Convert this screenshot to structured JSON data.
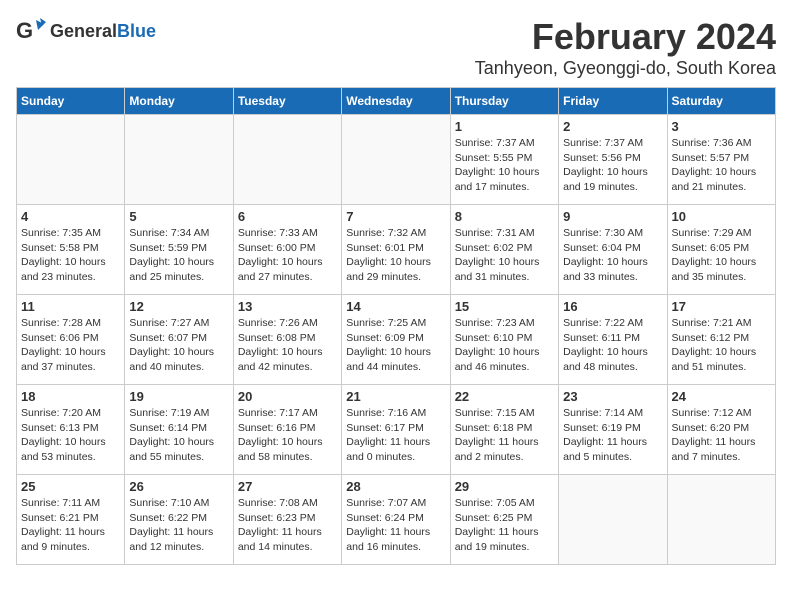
{
  "header": {
    "logo_general": "General",
    "logo_blue": "Blue",
    "month_year": "February 2024",
    "location": "Tanhyeon, Gyeonggi-do, South Korea"
  },
  "weekdays": [
    "Sunday",
    "Monday",
    "Tuesday",
    "Wednesday",
    "Thursday",
    "Friday",
    "Saturday"
  ],
  "weeks": [
    [
      {
        "day": "",
        "info": ""
      },
      {
        "day": "",
        "info": ""
      },
      {
        "day": "",
        "info": ""
      },
      {
        "day": "",
        "info": ""
      },
      {
        "day": "1",
        "info": "Sunrise: 7:37 AM\nSunset: 5:55 PM\nDaylight: 10 hours\nand 17 minutes."
      },
      {
        "day": "2",
        "info": "Sunrise: 7:37 AM\nSunset: 5:56 PM\nDaylight: 10 hours\nand 19 minutes."
      },
      {
        "day": "3",
        "info": "Sunrise: 7:36 AM\nSunset: 5:57 PM\nDaylight: 10 hours\nand 21 minutes."
      }
    ],
    [
      {
        "day": "4",
        "info": "Sunrise: 7:35 AM\nSunset: 5:58 PM\nDaylight: 10 hours\nand 23 minutes."
      },
      {
        "day": "5",
        "info": "Sunrise: 7:34 AM\nSunset: 5:59 PM\nDaylight: 10 hours\nand 25 minutes."
      },
      {
        "day": "6",
        "info": "Sunrise: 7:33 AM\nSunset: 6:00 PM\nDaylight: 10 hours\nand 27 minutes."
      },
      {
        "day": "7",
        "info": "Sunrise: 7:32 AM\nSunset: 6:01 PM\nDaylight: 10 hours\nand 29 minutes."
      },
      {
        "day": "8",
        "info": "Sunrise: 7:31 AM\nSunset: 6:02 PM\nDaylight: 10 hours\nand 31 minutes."
      },
      {
        "day": "9",
        "info": "Sunrise: 7:30 AM\nSunset: 6:04 PM\nDaylight: 10 hours\nand 33 minutes."
      },
      {
        "day": "10",
        "info": "Sunrise: 7:29 AM\nSunset: 6:05 PM\nDaylight: 10 hours\nand 35 minutes."
      }
    ],
    [
      {
        "day": "11",
        "info": "Sunrise: 7:28 AM\nSunset: 6:06 PM\nDaylight: 10 hours\nand 37 minutes."
      },
      {
        "day": "12",
        "info": "Sunrise: 7:27 AM\nSunset: 6:07 PM\nDaylight: 10 hours\nand 40 minutes."
      },
      {
        "day": "13",
        "info": "Sunrise: 7:26 AM\nSunset: 6:08 PM\nDaylight: 10 hours\nand 42 minutes."
      },
      {
        "day": "14",
        "info": "Sunrise: 7:25 AM\nSunset: 6:09 PM\nDaylight: 10 hours\nand 44 minutes."
      },
      {
        "day": "15",
        "info": "Sunrise: 7:23 AM\nSunset: 6:10 PM\nDaylight: 10 hours\nand 46 minutes."
      },
      {
        "day": "16",
        "info": "Sunrise: 7:22 AM\nSunset: 6:11 PM\nDaylight: 10 hours\nand 48 minutes."
      },
      {
        "day": "17",
        "info": "Sunrise: 7:21 AM\nSunset: 6:12 PM\nDaylight: 10 hours\nand 51 minutes."
      }
    ],
    [
      {
        "day": "18",
        "info": "Sunrise: 7:20 AM\nSunset: 6:13 PM\nDaylight: 10 hours\nand 53 minutes."
      },
      {
        "day": "19",
        "info": "Sunrise: 7:19 AM\nSunset: 6:14 PM\nDaylight: 10 hours\nand 55 minutes."
      },
      {
        "day": "20",
        "info": "Sunrise: 7:17 AM\nSunset: 6:16 PM\nDaylight: 10 hours\nand 58 minutes."
      },
      {
        "day": "21",
        "info": "Sunrise: 7:16 AM\nSunset: 6:17 PM\nDaylight: 11 hours\nand 0 minutes."
      },
      {
        "day": "22",
        "info": "Sunrise: 7:15 AM\nSunset: 6:18 PM\nDaylight: 11 hours\nand 2 minutes."
      },
      {
        "day": "23",
        "info": "Sunrise: 7:14 AM\nSunset: 6:19 PM\nDaylight: 11 hours\nand 5 minutes."
      },
      {
        "day": "24",
        "info": "Sunrise: 7:12 AM\nSunset: 6:20 PM\nDaylight: 11 hours\nand 7 minutes."
      }
    ],
    [
      {
        "day": "25",
        "info": "Sunrise: 7:11 AM\nSunset: 6:21 PM\nDaylight: 11 hours\nand 9 minutes."
      },
      {
        "day": "26",
        "info": "Sunrise: 7:10 AM\nSunset: 6:22 PM\nDaylight: 11 hours\nand 12 minutes."
      },
      {
        "day": "27",
        "info": "Sunrise: 7:08 AM\nSunset: 6:23 PM\nDaylight: 11 hours\nand 14 minutes."
      },
      {
        "day": "28",
        "info": "Sunrise: 7:07 AM\nSunset: 6:24 PM\nDaylight: 11 hours\nand 16 minutes."
      },
      {
        "day": "29",
        "info": "Sunrise: 7:05 AM\nSunset: 6:25 PM\nDaylight: 11 hours\nand 19 minutes."
      },
      {
        "day": "",
        "info": ""
      },
      {
        "day": "",
        "info": ""
      }
    ]
  ]
}
